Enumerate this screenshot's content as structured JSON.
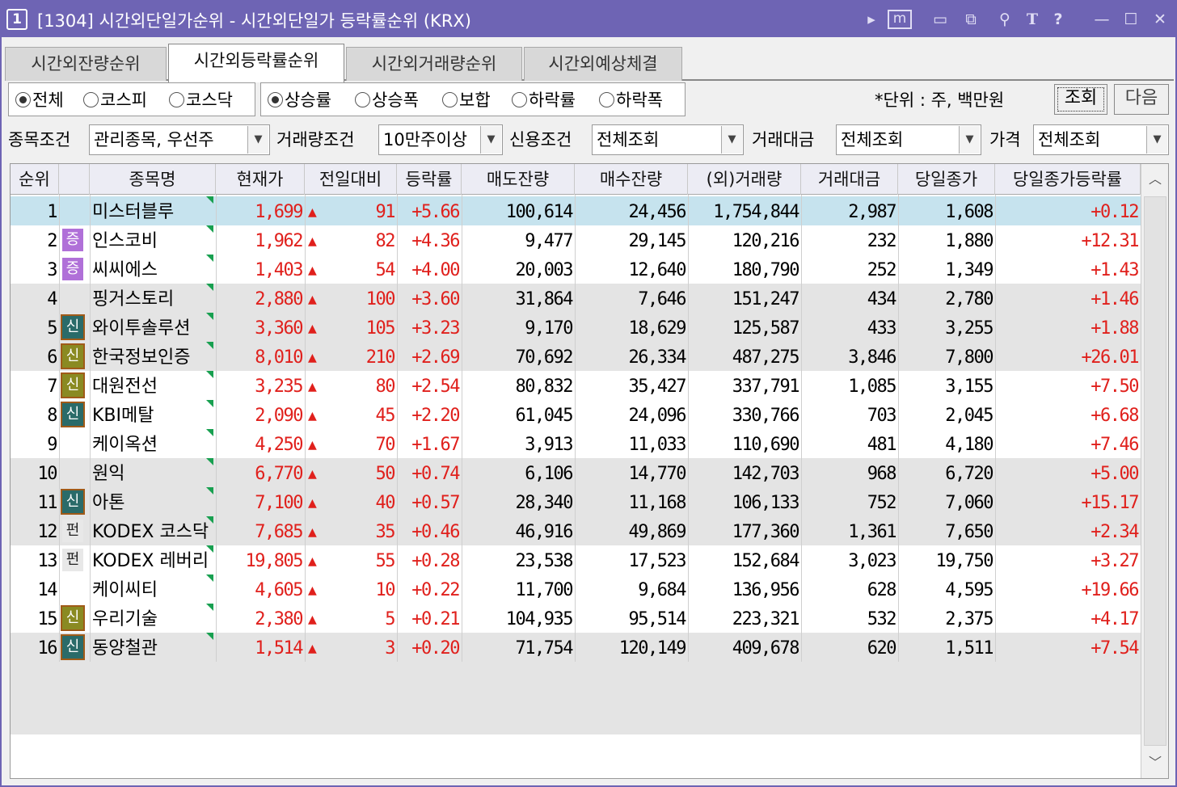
{
  "window": {
    "number": "1",
    "title": "[1304] 시간외단일가순위 - 시간외단일가 등락률순위 (KRX)"
  },
  "titlebar_icons": [
    "play-icon",
    "m-icon",
    "window-icon",
    "window-copy-icon",
    "pin-icon",
    "text-T-icon",
    "help-icon",
    "minimize-icon",
    "maximize-icon",
    "close-icon"
  ],
  "titlebar_glyphs": {
    "play": "▸",
    "m": "m",
    "win": "▭",
    "copy": "⧉",
    "pin": "⚲",
    "T": "T",
    "help": "?",
    "min": "—",
    "max": "☐",
    "close": "✕"
  },
  "tabs": [
    {
      "label": "시간외잔량순위",
      "active": false
    },
    {
      "label": "시간외등락률순위",
      "active": true
    },
    {
      "label": "시간외거래량순위",
      "active": false
    },
    {
      "label": "시간외예상체결",
      "active": false
    }
  ],
  "market_radios": [
    {
      "label": "전체",
      "checked": true
    },
    {
      "label": "코스피",
      "checked": false
    },
    {
      "label": "코스닥",
      "checked": false
    }
  ],
  "type_radios": [
    {
      "label": "상승률",
      "checked": true
    },
    {
      "label": "상승폭",
      "checked": false
    },
    {
      "label": "보합",
      "checked": false
    },
    {
      "label": "하락률",
      "checked": false
    },
    {
      "label": "하락폭",
      "checked": false
    }
  ],
  "unit_text": "*단위 : 주, 백만원",
  "buttons": {
    "query": "조회",
    "next": "다음"
  },
  "filters": [
    {
      "label": "종목조건",
      "value": "관리종목, 우선주"
    },
    {
      "label": "거래량조건",
      "value": "10만주이상"
    },
    {
      "label": "신용조건",
      "value": "전체조회"
    },
    {
      "label": "거래대금",
      "value": "전체조회"
    },
    {
      "label": "가격",
      "value": "전체조회"
    }
  ],
  "columns": [
    "순위",
    "",
    "종목명",
    "현재가",
    "전일대비",
    "등락률",
    "매도잔량",
    "매수잔량",
    "(외)거래량",
    "거래대금",
    "당일종가",
    "당일종가등락률"
  ],
  "up_symbol": "▲",
  "rows": [
    {
      "rank": "1",
      "badge": "",
      "name": "미스터블루",
      "price": "1,699",
      "change": "91",
      "rate": "+5.66",
      "ask": "100,614",
      "bid": "24,456",
      "volume": "1,754,844",
      "amount": "2,987",
      "close": "1,608",
      "close_rate": "+0.12",
      "selected": true
    },
    {
      "rank": "2",
      "badge": "증",
      "name": "인스코비",
      "price": "1,962",
      "change": "82",
      "rate": "+4.36",
      "ask": "9,477",
      "bid": "29,145",
      "volume": "120,216",
      "amount": "232",
      "close": "1,880",
      "close_rate": "+12.31"
    },
    {
      "rank": "3",
      "badge": "증",
      "name": "씨씨에스",
      "price": "1,403",
      "change": "54",
      "rate": "+4.00",
      "ask": "20,003",
      "bid": "12,640",
      "volume": "180,790",
      "amount": "252",
      "close": "1,349",
      "close_rate": "+1.43"
    },
    {
      "rank": "4",
      "badge": "",
      "name": "핑거스토리",
      "price": "2,880",
      "change": "100",
      "rate": "+3.60",
      "ask": "31,864",
      "bid": "7,646",
      "volume": "151,247",
      "amount": "434",
      "close": "2,780",
      "close_rate": "+1.46"
    },
    {
      "rank": "5",
      "badge": "신",
      "name": "와이투솔루션",
      "price": "3,360",
      "change": "105",
      "rate": "+3.23",
      "ask": "9,170",
      "bid": "18,629",
      "volume": "125,587",
      "amount": "433",
      "close": "3,255",
      "close_rate": "+1.88"
    },
    {
      "rank": "6",
      "badge": "신",
      "name": "한국정보인증",
      "price": "8,010",
      "change": "210",
      "rate": "+2.69",
      "ask": "70,692",
      "bid": "26,334",
      "volume": "487,275",
      "amount": "3,846",
      "close": "7,800",
      "close_rate": "+26.01"
    },
    {
      "rank": "7",
      "badge": "신",
      "name": "대원전선",
      "price": "3,235",
      "change": "80",
      "rate": "+2.54",
      "ask": "80,832",
      "bid": "35,427",
      "volume": "337,791",
      "amount": "1,085",
      "close": "3,155",
      "close_rate": "+7.50"
    },
    {
      "rank": "8",
      "badge": "신",
      "name": "KBI메탈",
      "price": "2,090",
      "change": "45",
      "rate": "+2.20",
      "ask": "61,045",
      "bid": "24,096",
      "volume": "330,766",
      "amount": "703",
      "close": "2,045",
      "close_rate": "+6.68"
    },
    {
      "rank": "9",
      "badge": "",
      "name": "케이옥션",
      "price": "4,250",
      "change": "70",
      "rate": "+1.67",
      "ask": "3,913",
      "bid": "11,033",
      "volume": "110,690",
      "amount": "481",
      "close": "4,180",
      "close_rate": "+7.46"
    },
    {
      "rank": "10",
      "badge": "",
      "name": "원익",
      "price": "6,770",
      "change": "50",
      "rate": "+0.74",
      "ask": "6,106",
      "bid": "14,770",
      "volume": "142,703",
      "amount": "968",
      "close": "6,720",
      "close_rate": "+5.00"
    },
    {
      "rank": "11",
      "badge": "신",
      "name": "아톤",
      "price": "7,100",
      "change": "40",
      "rate": "+0.57",
      "ask": "28,340",
      "bid": "11,168",
      "volume": "106,133",
      "amount": "752",
      "close": "7,060",
      "close_rate": "+15.17"
    },
    {
      "rank": "12",
      "badge": "펀",
      "name": "KODEX 코스닥",
      "price": "7,685",
      "change": "35",
      "rate": "+0.46",
      "ask": "46,916",
      "bid": "49,869",
      "volume": "177,360",
      "amount": "1,361",
      "close": "7,650",
      "close_rate": "+2.34"
    },
    {
      "rank": "13",
      "badge": "펀",
      "name": "KODEX 레버리",
      "price": "19,805",
      "change": "55",
      "rate": "+0.28",
      "ask": "23,538",
      "bid": "17,523",
      "volume": "152,684",
      "amount": "3,023",
      "close": "19,750",
      "close_rate": "+3.27"
    },
    {
      "rank": "14",
      "badge": "",
      "name": "케이씨티",
      "price": "4,605",
      "change": "10",
      "rate": "+0.22",
      "ask": "11,700",
      "bid": "9,684",
      "volume": "136,956",
      "amount": "628",
      "close": "4,595",
      "close_rate": "+19.66"
    },
    {
      "rank": "15",
      "badge": "신",
      "name": "우리기술",
      "price": "2,380",
      "change": "5",
      "rate": "+0.21",
      "ask": "104,935",
      "bid": "95,514",
      "volume": "223,321",
      "amount": "532",
      "close": "2,375",
      "close_rate": "+4.17"
    },
    {
      "rank": "16",
      "badge": "신",
      "name": "동양철관",
      "price": "1,514",
      "change": "3",
      "rate": "+0.20",
      "ask": "71,754",
      "bid": "120,149",
      "volume": "409,678",
      "amount": "620",
      "close": "1,511",
      "close_rate": "+7.54"
    }
  ],
  "scrollbar": {
    "up": "︿",
    "down": "﹀"
  }
}
